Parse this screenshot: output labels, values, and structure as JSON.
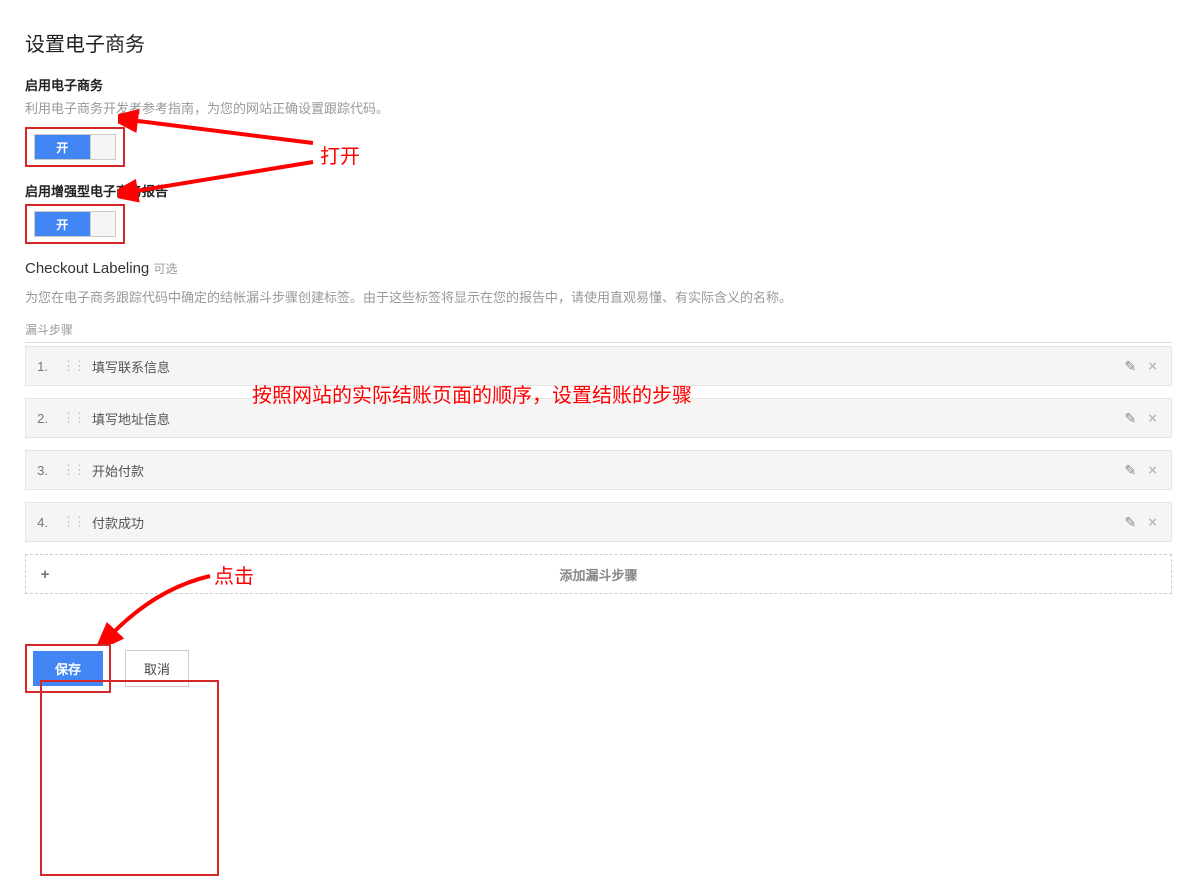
{
  "page": {
    "title": "设置电子商务"
  },
  "ecommerce": {
    "enable_title": "启用电子商务",
    "enable_desc": "利用电子商务开发者参考指南，为您的网站正确设置跟踪代码。",
    "toggle_label": "开",
    "enhanced_title": "启用增强型电子商务报告"
  },
  "checkout": {
    "header": "Checkout Labeling",
    "optional": "可选",
    "desc": "为您在电子商务跟踪代码中确定的结帐漏斗步骤创建标签。由于这些标签将显示在您的报告中，请使用直观易懂、有实际含义的名称。",
    "funnel_label": "漏斗步骤",
    "steps": [
      {
        "num": "1.",
        "label": "填写联系信息"
      },
      {
        "num": "2.",
        "label": "填写地址信息"
      },
      {
        "num": "3.",
        "label": "开始付款"
      },
      {
        "num": "4.",
        "label": "付款成功"
      }
    ],
    "add_label": "添加漏斗步骤"
  },
  "buttons": {
    "save": "保存",
    "cancel": "取消"
  },
  "annotations": {
    "open": "打开",
    "steps": "按照网站的实际结账页面的顺序，设置结账的步骤",
    "click": "点击"
  }
}
